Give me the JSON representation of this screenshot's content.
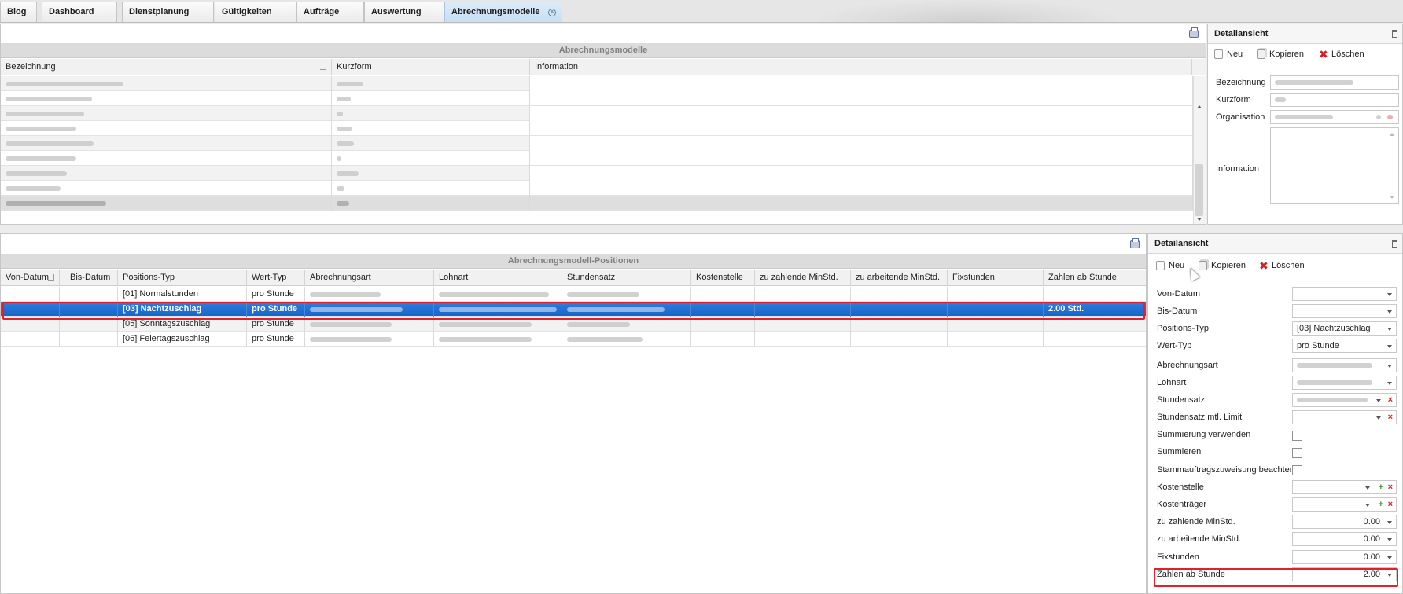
{
  "tabs": [
    {
      "label": "Blog"
    },
    {
      "label": "Dashboard"
    },
    {
      "label": "Dienstplanung"
    },
    {
      "label": "Gültigkeiten"
    },
    {
      "label": "Aufträge"
    },
    {
      "label": "Auswertung"
    },
    {
      "label": "Abrechnungsmodelle",
      "active": true,
      "closable": true
    }
  ],
  "models": {
    "caption": "Abrechnungsmodelle",
    "columns": [
      "Bezeichnung",
      "Kurzform",
      "Information"
    ],
    "row_count": 9,
    "selected_row": 9
  },
  "detail_top": {
    "title": "Detailansicht",
    "actions": {
      "new": "Neu",
      "copy": "Kopieren",
      "delete": "Löschen"
    },
    "fields": {
      "bezeichnung": "Bezeichnung",
      "kurzform": "Kurzform",
      "organisation": "Organisation",
      "information": "Information"
    }
  },
  "positions": {
    "caption": "Abrechnungsmodell-Positionen",
    "columns": [
      "Von-Datum",
      "Bis-Datum",
      "Positions-Typ",
      "Wert-Typ",
      "Abrechnungsart",
      "Lohnart",
      "Stundensatz",
      "Kostenstelle",
      "zu zahlende MinStd.",
      "zu arbeitende MinStd.",
      "Fixstunden",
      "Zahlen ab Stunde"
    ],
    "rows": [
      {
        "positions_typ": "[01] Normalstunden",
        "wert_typ": "pro Stunde",
        "zahlen_ab": ""
      },
      {
        "positions_typ": "[03] Nachtzuschlag",
        "wert_typ": "pro Stunde",
        "zahlen_ab": "2.00  Std.",
        "selected": true
      },
      {
        "positions_typ": "[05] Sonntagszuschlag",
        "wert_typ": "pro Stunde",
        "zahlen_ab": ""
      },
      {
        "positions_typ": "[06] Feiertagszuschlag",
        "wert_typ": "pro Stunde",
        "zahlen_ab": ""
      }
    ]
  },
  "detail_bottom": {
    "title": "Detailansicht",
    "actions": {
      "new": "Neu",
      "copy": "Kopieren",
      "delete": "Löschen"
    },
    "labels": {
      "von_datum": "Von-Datum",
      "bis_datum": "Bis-Datum",
      "positions_typ": "Positions-Typ",
      "wert_typ": "Wert-Typ",
      "abrechnungsart": "Abrechnungsart",
      "lohnart": "Lohnart",
      "stundensatz": "Stundensatz",
      "stundensatz_limit": "Stundensatz mtl. Limit",
      "summierung_verwenden": "Summierung verwenden",
      "summieren": "Summieren",
      "stammauftrag": "Stammauftragszuweisung beachten",
      "kostenstelle": "Kostenstelle",
      "kostentraeger": "Kostenträger",
      "zu_zahlende": "zu zahlende MinStd.",
      "zu_arbeitende": "zu arbeitende MinStd.",
      "fixstunden": "Fixstunden",
      "zahlen_ab": "Zahlen ab Stunde"
    },
    "values": {
      "von_datum": "",
      "bis_datum": "",
      "positions_typ": "[03] Nachtzuschlag",
      "wert_typ": "pro Stunde",
      "zu_zahlende": "0.00",
      "zu_arbeitende": "0.00",
      "fixstunden": "0.00",
      "zahlen_ab": "2.00"
    }
  },
  "colors": {
    "selection": "#1566c9",
    "highlight": "#e0202a",
    "delete": "#d42020",
    "add": "#2a9a2a"
  }
}
